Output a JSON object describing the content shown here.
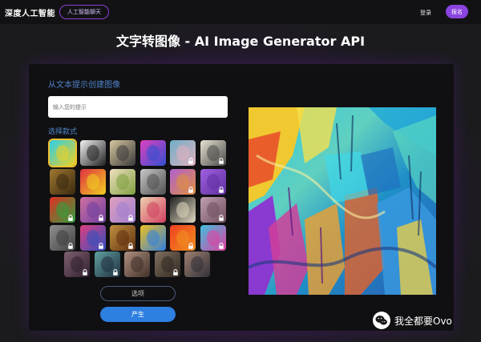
{
  "header": {
    "brand": "深度人工智能",
    "chat_button": "人工智能聊天",
    "login": "登录",
    "signup": "报名"
  },
  "page_title": "文字转图像 - AI Image Generator API",
  "form": {
    "prompt_label": "从文本提示创建图像",
    "prompt_placeholder": "输入您的提示",
    "style_label": "选择款式",
    "options_button": "选项",
    "generate_button": "产生"
  },
  "styles": [
    {
      "icon": "abstract-colorful-thumbnail",
      "locked": false,
      "selected": true,
      "c1": "#2ad0e8",
      "c2": "#f0d020"
    },
    {
      "icon": "panda-thumbnail",
      "locked": false,
      "selected": false,
      "c1": "#f2f2f2",
      "c2": "#222222"
    },
    {
      "icon": "landscape-thumbnail",
      "locked": false,
      "selected": false,
      "c1": "#d8c8a0",
      "c2": "#3a3a3a"
    },
    {
      "icon": "robot-thumbnail",
      "locked": false,
      "selected": false,
      "c1": "#e040c0",
      "c2": "#3050d0"
    },
    {
      "icon": "woman-portrait-thumbnail",
      "locked": true,
      "selected": false,
      "c1": "#6fb0c8",
      "c2": "#e0b0c0"
    },
    {
      "icon": "sketch-thumbnail",
      "locked": true,
      "selected": false,
      "c1": "#e8e2d0",
      "c2": "#4a4a4a"
    },
    {
      "icon": "mona-lisa-thumbnail",
      "locked": false,
      "selected": false,
      "c1": "#a07830",
      "c2": "#3a2a10"
    },
    {
      "icon": "flowers-thumbnail",
      "locked": false,
      "selected": false,
      "c1": "#e03040",
      "c2": "#f0d020"
    },
    {
      "icon": "fruit-painting-thumbnail",
      "locked": false,
      "selected": false,
      "c1": "#f0e0c0",
      "c2": "#80a040"
    },
    {
      "icon": "sphere-thumbnail",
      "locked": false,
      "selected": false,
      "c1": "#c8c8c8",
      "c2": "#505050"
    },
    {
      "icon": "cube-thumbnail",
      "locked": true,
      "selected": false,
      "c1": "#b060d0",
      "c2": "#e09040"
    },
    {
      "icon": "purple-abstract-thumbnail",
      "locked": true,
      "selected": false,
      "c1": "#a060e0",
      "c2": "#6030a0"
    },
    {
      "icon": "red-figure-thumbnail",
      "locked": true,
      "selected": false,
      "c1": "#e03020",
      "c2": "#30a040"
    },
    {
      "icon": "pink-portrait-thumbnail",
      "locked": true,
      "selected": false,
      "c1": "#d070a0",
      "c2": "#7040a0"
    },
    {
      "icon": "pastel-portrait-thumbnail",
      "locked": true,
      "selected": false,
      "c1": "#e0a0c0",
      "c2": "#a080d0"
    },
    {
      "icon": "marilyn-thumbnail",
      "locked": false,
      "selected": false,
      "c1": "#f0d0b0",
      "c2": "#d04060"
    },
    {
      "icon": "house-thumbnail",
      "locked": false,
      "selected": false,
      "c1": "#202020",
      "c2": "#e0d8c0"
    },
    {
      "icon": "blurred-portrait-thumbnail",
      "locked": true,
      "selected": false,
      "c1": "#c0a0b0",
      "c2": "#705060"
    },
    {
      "icon": "grey-figure-thumbnail",
      "locked": true,
      "selected": false,
      "c1": "#909090",
      "c2": "#404040"
    },
    {
      "icon": "colorful-face-thumbnail",
      "locked": true,
      "selected": false,
      "c1": "#e04080",
      "c2": "#3050c0"
    },
    {
      "icon": "golden-figure-thumbnail",
      "locked": true,
      "selected": false,
      "c1": "#c09040",
      "c2": "#603010"
    },
    {
      "icon": "pop-art-grid-thumbnail",
      "locked": false,
      "selected": false,
      "c1": "#f0c020",
      "c2": "#3080e0"
    },
    {
      "icon": "red-abstract-thumbnail",
      "locked": true,
      "selected": false,
      "c1": "#f04020",
      "c2": "#f09020"
    },
    {
      "icon": "rainbow-abstract-thumbnail",
      "locked": true,
      "selected": false,
      "c1": "#40c0e0",
      "c2": "#e040a0"
    },
    {
      "icon": "dark-portrait-thumbnail",
      "locked": true,
      "selected": false,
      "c1": "#806070",
      "c2": "#302030"
    },
    {
      "icon": "teal-portrait-thumbnail",
      "locked": true,
      "selected": false,
      "c1": "#60a0a0",
      "c2": "#203040"
    },
    {
      "icon": "bust-thumbnail",
      "locked": false,
      "selected": false,
      "c1": "#b09080",
      "c2": "#403028"
    },
    {
      "icon": "soldier-portrait-thumbnail",
      "locked": true,
      "selected": false,
      "c1": "#807060",
      "c2": "#302820"
    },
    {
      "icon": "man-portrait-thumbnail",
      "locked": false,
      "selected": false,
      "c1": "#a08070",
      "c2": "#303038"
    }
  ],
  "watermark": {
    "text": "我全都要Ovo",
    "icon": "wechat-icon"
  }
}
